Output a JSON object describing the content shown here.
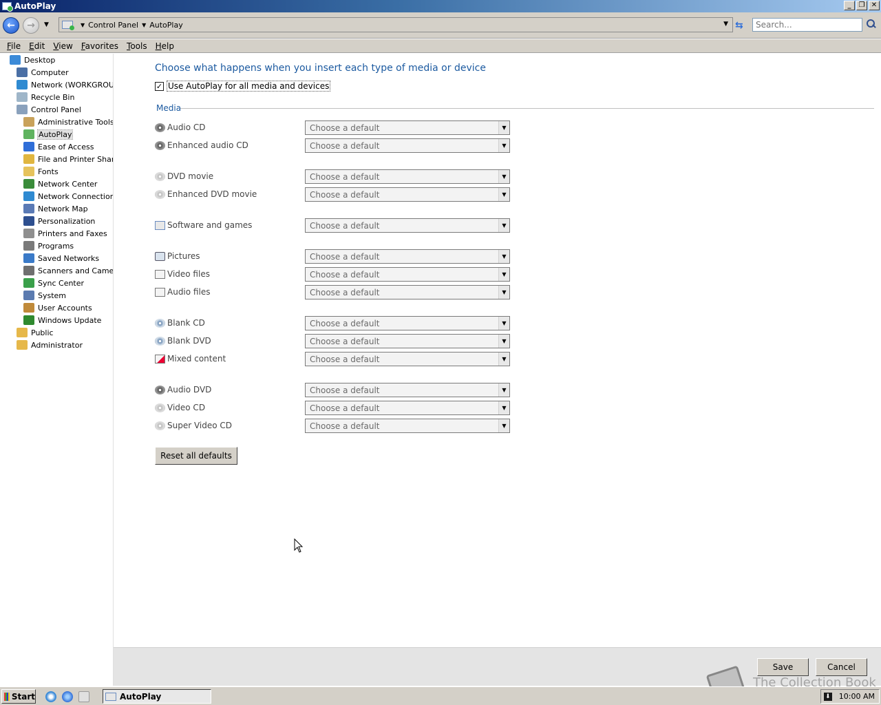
{
  "window": {
    "title": "AutoPlay"
  },
  "address": {
    "crumbs": [
      "Control Panel",
      "AutoPlay"
    ],
    "search_placeholder": "Search..."
  },
  "menu": [
    "File",
    "Edit",
    "View",
    "Favorites",
    "Tools",
    "Help"
  ],
  "tree": [
    {
      "label": "Desktop",
      "icon": "desktop-icon",
      "color": "#3b8ad8",
      "level": 0
    },
    {
      "label": "Computer",
      "icon": "computer-icon",
      "color": "#4a6fa5",
      "level": 1
    },
    {
      "label": "Network (WORKGROUP)",
      "icon": "network-icon",
      "color": "#2f8ad1",
      "level": 1
    },
    {
      "label": "Recycle Bin",
      "icon": "recycle-bin-icon",
      "color": "#9fb6c9",
      "level": 1
    },
    {
      "label": "Control Panel",
      "icon": "control-panel-icon",
      "color": "#8aa1bc",
      "level": 1
    },
    {
      "label": "Administrative Tools",
      "icon": "admin-tools-icon",
      "color": "#c9a25b",
      "level": 2
    },
    {
      "label": "AutoPlay",
      "icon": "autoplay-icon",
      "color": "#5fb35f",
      "level": 2,
      "selected": true
    },
    {
      "label": "Ease of Access",
      "icon": "ease-of-access-icon",
      "color": "#2f6ed8",
      "level": 2
    },
    {
      "label": "File and Printer Sharing",
      "icon": "file-sharing-icon",
      "color": "#e0b640",
      "level": 2
    },
    {
      "label": "Fonts",
      "icon": "fonts-icon",
      "color": "#e6c35c",
      "level": 2
    },
    {
      "label": "Network Center",
      "icon": "network-center-icon",
      "color": "#3a8c3a",
      "level": 2
    },
    {
      "label": "Network Connections",
      "icon": "network-connections-icon",
      "color": "#2f8ad1",
      "level": 2
    },
    {
      "label": "Network Map",
      "icon": "network-map-icon",
      "color": "#5a7ab5",
      "level": 2
    },
    {
      "label": "Personalization",
      "icon": "personalization-icon",
      "color": "#2e4f8f",
      "level": 2
    },
    {
      "label": "Printers and Faxes",
      "icon": "printer-icon",
      "color": "#8f8f8f",
      "level": 2
    },
    {
      "label": "Programs",
      "icon": "programs-icon",
      "color": "#7a7a7a",
      "level": 2
    },
    {
      "label": "Saved Networks",
      "icon": "saved-networks-icon",
      "color": "#3a7ac8",
      "level": 2
    },
    {
      "label": "Scanners and Cameras",
      "icon": "scanner-icon",
      "color": "#6f6f6f",
      "level": 2
    },
    {
      "label": "Sync Center",
      "icon": "sync-icon",
      "color": "#3aa04a",
      "level": 2
    },
    {
      "label": "System",
      "icon": "system-icon",
      "color": "#5b7bb0",
      "level": 2
    },
    {
      "label": "User Accounts",
      "icon": "user-accounts-icon",
      "color": "#c08a3a",
      "level": 2
    },
    {
      "label": "Windows Update",
      "icon": "windows-update-icon",
      "color": "#2f8a2f",
      "level": 2
    },
    {
      "label": "Public",
      "icon": "folder-icon",
      "color": "#e6b84a",
      "level": 1
    },
    {
      "label": "Administrator",
      "icon": "folder-icon",
      "color": "#e6b84a",
      "level": 1
    }
  ],
  "main": {
    "heading": "Choose what happens when you insert each type of media or device",
    "use_autoplay_label": "Use AutoPlay for all media and devices",
    "use_autoplay_checked": "✓",
    "media_legend": "Media",
    "select_placeholder": "Choose a default",
    "media": [
      {
        "label": "Audio CD",
        "icon": "cd-dark"
      },
      {
        "label": "Enhanced audio CD",
        "icon": "cd-dark"
      },
      {
        "label": "DVD movie",
        "icon": "disc"
      },
      {
        "label": "Enhanced DVD movie",
        "icon": "disc"
      },
      {
        "label": "Software and games",
        "icon": "win"
      },
      {
        "label": "Pictures",
        "icon": "pic"
      },
      {
        "label": "Video files",
        "icon": "doc"
      },
      {
        "label": "Audio files",
        "icon": "doc"
      },
      {
        "label": "Blank CD",
        "icon": "blank"
      },
      {
        "label": "Blank DVD",
        "icon": "blank"
      },
      {
        "label": "Mixed content",
        "icon": "mix"
      },
      {
        "label": "Audio DVD",
        "icon": "cd-dark"
      },
      {
        "label": "Video CD",
        "icon": "disc"
      },
      {
        "label": "Super Video CD",
        "icon": "disc"
      }
    ],
    "reset_label": "Reset all defaults"
  },
  "buttons": {
    "save": "Save",
    "cancel": "Cancel"
  },
  "watermark": "The Collection Book",
  "taskbar": {
    "start": "Start",
    "task": "AutoPlay",
    "clock": "10:00 AM"
  }
}
